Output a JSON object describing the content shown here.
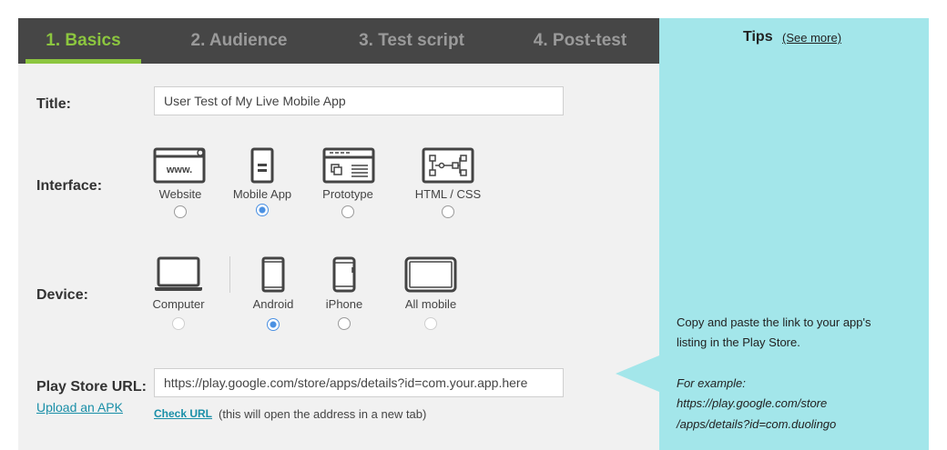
{
  "tabs": [
    {
      "label": "1. Basics",
      "active": true
    },
    {
      "label": "2. Audience",
      "active": false
    },
    {
      "label": "3. Test script",
      "active": false
    },
    {
      "label": "4. Post-test",
      "active": false
    }
  ],
  "title_row": {
    "label": "Title:",
    "value": "User Test of My Live Mobile App"
  },
  "interface_row": {
    "label": "Interface:",
    "options": [
      {
        "label": "Website",
        "icon": "browser-www-icon",
        "selected": false,
        "icon_text": "www."
      },
      {
        "label": "Mobile App",
        "icon": "mobile-app-icon",
        "selected": true
      },
      {
        "label": "Prototype",
        "icon": "prototype-icon",
        "selected": false
      },
      {
        "label": "HTML / CSS",
        "icon": "html-css-icon",
        "selected": false
      }
    ]
  },
  "device_row": {
    "label": "Device:",
    "options": [
      {
        "label": "Computer",
        "icon": "laptop-icon",
        "selected": false
      },
      {
        "label": "Android",
        "icon": "android-phone-icon",
        "selected": true
      },
      {
        "label": "iPhone",
        "icon": "iphone-icon",
        "selected": false
      },
      {
        "label": "All mobile",
        "icon": "tablet-icon",
        "selected": false
      }
    ]
  },
  "url_row": {
    "label": "Play Store URL:",
    "upload_link": "Upload an APK",
    "value": "https://play.google.com/store/apps/details?id=com.your.app.here",
    "check_link": "Check URL",
    "check_note": "(this will open the address in a new tab)"
  },
  "tips": {
    "title": "Tips",
    "see_more": "(See more)",
    "line1": "Copy and paste the link to your app's",
    "line2": "listing in the Play Store.",
    "example_label": "For example:",
    "example_line1": "https://play.google.com/store",
    "example_line2": "/apps/details?id=com.duolingo"
  },
  "colors": {
    "tabbar_bg": "#464646",
    "tab_active": "#8cc63f",
    "tab_inactive": "#9a9a9a",
    "panel_bg": "#f1f1f1",
    "tips_bg": "#a3e6ea",
    "radio_selected": "#4a90e2",
    "link": "#1a8fa8"
  }
}
